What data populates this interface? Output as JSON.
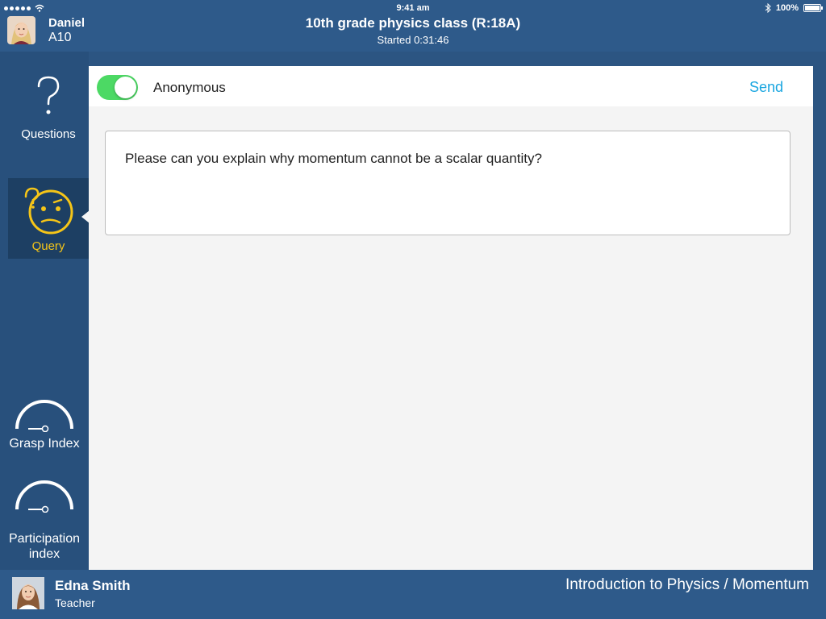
{
  "status_bar": {
    "time": "9:41 am",
    "battery": "100%",
    "icons": [
      "signal-dots-icon",
      "wifi-icon",
      "bluetooth-icon",
      "battery-icon"
    ]
  },
  "header": {
    "user": {
      "name": "Daniel",
      "code": "A10"
    },
    "class_title": "10th grade physics class (R:18A)",
    "started": "Started 0:31:46"
  },
  "sidebar": {
    "items": [
      {
        "label": "Questions",
        "icon": "question-mark-icon"
      },
      {
        "label": "Query",
        "icon": "confused-face-icon",
        "active": true
      },
      {
        "label": "Grasp Index",
        "icon": "gauge-icon"
      },
      {
        "label_line1": "Participation",
        "label_line2": "index",
        "icon": "gauge-icon"
      }
    ]
  },
  "main": {
    "anonymous_label": "Anonymous",
    "anonymous_on": true,
    "send_label": "Send",
    "query_text": "Please can you explain why momentum cannot be a scalar quantity?"
  },
  "footer": {
    "teacher_name": "Edna Smith",
    "teacher_role": "Teacher",
    "course_path": "Introduction to Physics / Momentum"
  },
  "colors": {
    "header_bg": "#2e5a8a",
    "sidebar_bg": "#28507c",
    "active_bg": "#1d3f63",
    "accent_yellow": "#f5c518",
    "toggle_green": "#4cd964",
    "send_blue": "#1aa6e0"
  }
}
